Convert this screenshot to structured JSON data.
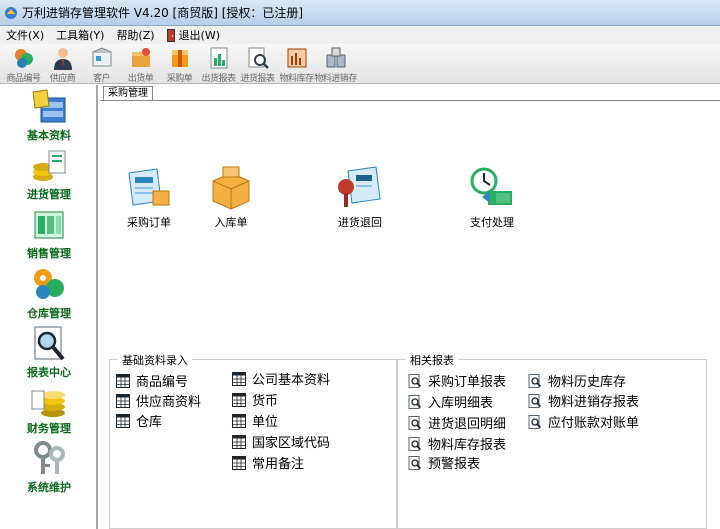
{
  "window": {
    "title": "万利进销存管理软件 V4.20 [商贸版] [授权：已注册]"
  },
  "menu": [
    {
      "label": "文件(X)"
    },
    {
      "label": "工具箱(Y)"
    },
    {
      "label": "帮助(Z)"
    },
    {
      "label": "退出(W)"
    }
  ],
  "toolbar": [
    {
      "label": "商品编号",
      "icon": "product-icon"
    },
    {
      "label": "供应商",
      "icon": "supplier-icon"
    },
    {
      "label": "客户",
      "icon": "customer-icon"
    },
    {
      "label": "出货单",
      "icon": "delivery-icon"
    },
    {
      "label": "采购单",
      "icon": "purchase-icon"
    },
    {
      "label": "出货报表",
      "icon": "delivery-report-icon"
    },
    {
      "label": "进货报表",
      "icon": "purchase-report-icon"
    },
    {
      "label": "物料库存",
      "icon": "inventory-icon"
    },
    {
      "label": "物料进销存",
      "icon": "material-flow-icon"
    }
  ],
  "sidebar": [
    {
      "label": "基本资料",
      "icon": "basic-data-icon"
    },
    {
      "label": "进货管理",
      "icon": "purchase-mgmt-icon"
    },
    {
      "label": "销售管理",
      "icon": "sales-mgmt-icon"
    },
    {
      "label": "仓库管理",
      "icon": "warehouse-mgmt-icon"
    },
    {
      "label": "报表中心",
      "icon": "report-center-icon"
    },
    {
      "label": "财务管理",
      "icon": "finance-mgmt-icon"
    },
    {
      "label": "系统维护",
      "icon": "system-maintenance-icon"
    }
  ],
  "tab": {
    "label": "采购管理"
  },
  "actions": [
    {
      "label": "采购订单",
      "icon": "purchase-order-icon"
    },
    {
      "label": "入库单",
      "icon": "stock-in-icon"
    },
    {
      "label": "进货退回",
      "icon": "purchase-return-icon"
    },
    {
      "label": "支付处理",
      "icon": "payment-icon"
    }
  ],
  "basic_data": {
    "title": "基础资料录入",
    "items": [
      "商品编号",
      "供应商资料",
      "仓库",
      "公司基本资料",
      "货币",
      "单位",
      "国家区域代码",
      "常用备注"
    ]
  },
  "reports": {
    "title": "相关报表",
    "items": [
      "采购订单报表",
      "入库明细表",
      "进货退回明细",
      "物料库存报表",
      "预警报表",
      "物料历史库存",
      "物料进销存报表",
      "应付账款对账单"
    ]
  },
  "colors": {
    "sidebar_text": "#0c6a1a",
    "titlebar": "#c8daef",
    "group_border": "#cfcfcf"
  }
}
